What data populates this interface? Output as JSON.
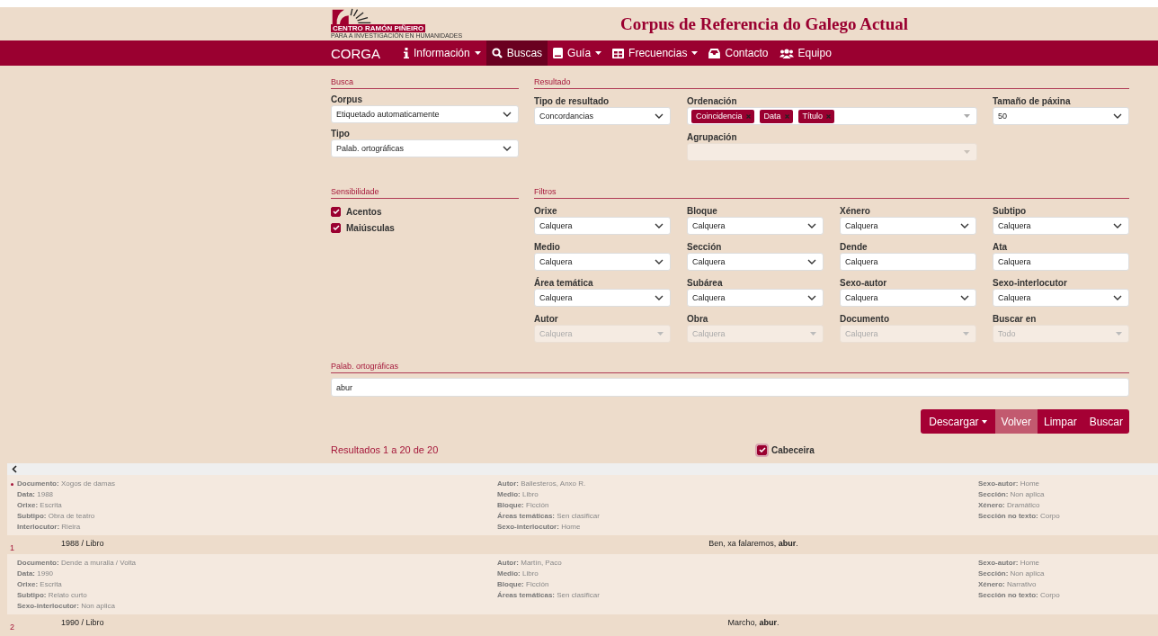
{
  "header": {
    "logo_name": "CENTRO RAMÓN PIÑEIRO",
    "logo_tagline": "PARA A INVESTIGACIÓN EN HUMANIDADES",
    "title": "Corpus de Referencia do Galego Actual"
  },
  "nav": {
    "brand": "CORGA",
    "items": [
      {
        "label": "Información",
        "dropdown": true,
        "selected": false
      },
      {
        "label": "Buscas",
        "dropdown": false,
        "selected": true
      },
      {
        "label": "Guía",
        "dropdown": true,
        "selected": false
      },
      {
        "label": "Frecuencias",
        "dropdown": true,
        "selected": false
      },
      {
        "label": "Contacto",
        "dropdown": false,
        "selected": false
      },
      {
        "label": "Equipo",
        "dropdown": false,
        "selected": false
      }
    ]
  },
  "busca": {
    "title": "Busca",
    "fields": [
      {
        "label": "Corpus",
        "kind": "select",
        "value": "Etiquetado automaticamente",
        "disabled": false
      },
      {
        "label": "Tipo",
        "kind": "select",
        "value": "Palab. ortográficas",
        "disabled": false
      }
    ]
  },
  "resultado": {
    "title": "Resultado",
    "fields": [
      {
        "label": "Tipo de resultado",
        "kind": "select",
        "value": "Concordancias",
        "disabled": false
      },
      {
        "label": "Ordenación",
        "kind": "tags",
        "tags": [
          "Coincidencia",
          "Data",
          "Título"
        ]
      },
      {
        "label": "Tamaño de páxina",
        "kind": "select",
        "value": "50",
        "disabled": false
      },
      {
        "label": "Agrupación",
        "kind": "select",
        "disabled": true
      }
    ]
  },
  "sensibilidade": {
    "title": "Sensibilidade",
    "options": [
      {
        "label": "Acentos",
        "checked": true
      },
      {
        "label": "Maiúsculas",
        "checked": true
      }
    ]
  },
  "filtros": {
    "title": "Filtros",
    "fields": [
      {
        "label": "Orixe",
        "kind": "select",
        "value": "Calquera",
        "disabled": false
      },
      {
        "label": "Bloque",
        "kind": "select",
        "value": "Calquera",
        "disabled": false
      },
      {
        "label": "Xénero",
        "kind": "select",
        "value": "Calquera",
        "disabled": false
      },
      {
        "label": "Subtipo",
        "kind": "select",
        "value": "Calquera",
        "disabled": false
      },
      {
        "label": "Medio",
        "kind": "select",
        "value": "Calquera",
        "disabled": false
      },
      {
        "label": "Sección",
        "kind": "select",
        "value": "Calquera",
        "disabled": false
      },
      {
        "label": "Dende",
        "kind": "input",
        "value": "Calquera"
      },
      {
        "label": "Ata",
        "kind": "input",
        "value": "Calquera"
      },
      {
        "label": "Área temática",
        "kind": "select",
        "value": "Calquera",
        "disabled": false
      },
      {
        "label": "Subárea",
        "kind": "select",
        "value": "Calquera",
        "disabled": false
      },
      {
        "label": "Sexo-autor",
        "kind": "select",
        "value": "Calquera",
        "disabled": false
      },
      {
        "label": "Sexo-interlocutor",
        "kind": "select",
        "value": "Calquera",
        "disabled": false
      },
      {
        "label": "Autor",
        "kind": "select",
        "placeholder": "Calquera",
        "disabled": true
      },
      {
        "label": "Obra",
        "kind": "select",
        "placeholder": "Calquera",
        "disabled": true
      },
      {
        "label": "Documento",
        "kind": "select",
        "placeholder": "Calquera",
        "disabled": true
      },
      {
        "label": "Buscar en",
        "kind": "select",
        "placeholder": "Todo",
        "disabled": true
      }
    ]
  },
  "query": {
    "title": "Palab. ortográficas",
    "value": "abur"
  },
  "buttons": [
    {
      "label": "Descargar",
      "dropdown": true,
      "selected": false
    },
    {
      "label": "Volver",
      "dropdown": false,
      "selected": true
    },
    {
      "label": "Limpar",
      "dropdown": false,
      "selected": false
    },
    {
      "label": "Buscar",
      "dropdown": false,
      "selected": false
    }
  ],
  "results_summary": "Resultados 1 a 20 de 20",
  "cabeceira": {
    "label": "Cabeceira",
    "checked": true
  },
  "results": [
    {
      "marked": true,
      "number": "1",
      "meta": [
        [
          "**Documento:** Xogos de damas",
          "**Data:** 1988",
          "**Orixe:** Escrita",
          "**Subtipo:** Obra de teatro",
          "**Interlocutor:** Rieira"
        ],
        [
          "**Autor:** Ballesteros, Anxo R.",
          "**Medio:** Libro",
          "**Bloque:** Ficción",
          "**Áreas temáticas:** Sen clasificar",
          "**Sexo-interlocutor:** Home"
        ],
        [
          "**Sexo-autor:** Home",
          "**Sección:** Non aplica",
          "**Xénero:** Dramático",
          "**Sección no texto:** Corpo"
        ]
      ],
      "source": "1988 / Libro",
      "concordance": "Ben, xa falaremos, **abur**."
    },
    {
      "marked": false,
      "number": "2",
      "meta": [
        [
          "**Documento:** Dende a muralla / Volta",
          "**Data:** 1990",
          "**Orixe:** Escrita",
          "**Subtipo:** Relato curto",
          "**Sexo-interlocutor:** Non aplica"
        ],
        [
          "**Autor:** Martín, Paco",
          "**Medio:** Libro",
          "**Bloque:** Ficción",
          "**Áreas temáticas:** Sen clasificar"
        ],
        [
          "**Sexo-autor:** Home",
          "**Sección:** Non aplica",
          "**Xénero:** Narrativo",
          "**Sección no texto:** Corpo"
        ]
      ],
      "source": "1990 / Libro",
      "concordance": "Marcho, **abur**."
    }
  ]
}
